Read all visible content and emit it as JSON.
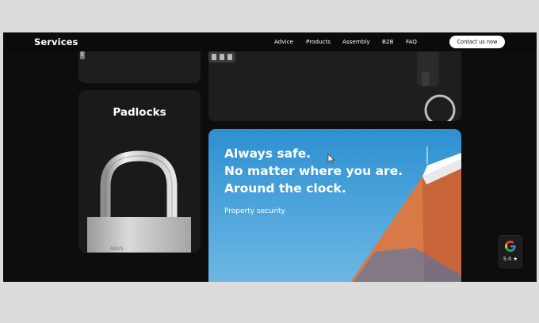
{
  "header": {
    "brand": "Services",
    "nav": [
      "Advice",
      "Products",
      "Assembly",
      "B2B",
      "FAQ"
    ],
    "cta_label": "Contact us now"
  },
  "cards": {
    "padlocks_title": "Padlocks"
  },
  "hero": {
    "lines": [
      "Always safe.",
      "No matter where you are.",
      "Around the clock."
    ],
    "subtitle": "Property security"
  },
  "google_badge": {
    "rating": "5.0 ★",
    "icon": "google-icon"
  },
  "colors": {
    "background": "#0d0d0d",
    "card": "#1e1e1e",
    "hero_sky": "#3b9ad6",
    "building_orange": "#c8643a"
  }
}
